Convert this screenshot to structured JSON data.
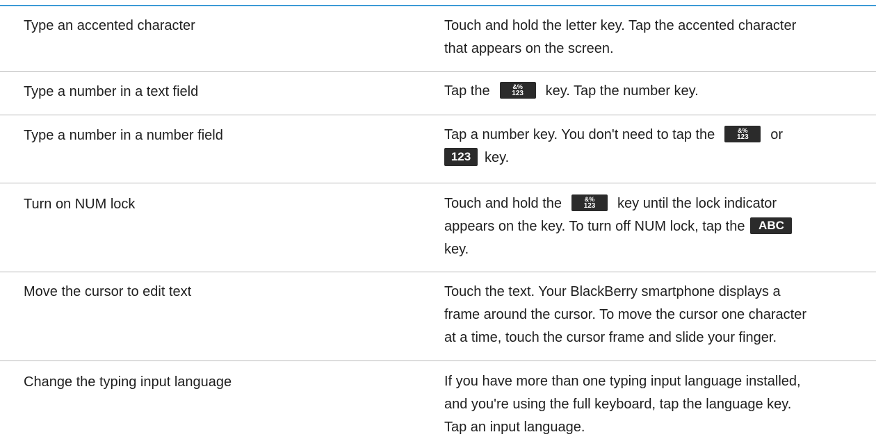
{
  "colors": {
    "rule": "#3d9ad6",
    "divider": "#b9b9b9",
    "key": "#2b2b2b"
  },
  "keys": {
    "symbol_top": "&%",
    "symbol_bottom": "123",
    "num": "123",
    "abc": "ABC"
  },
  "rows": [
    {
      "action": "Type an accented character",
      "lines": [
        "Touch and hold the letter key. Tap the accented character",
        "that appears on the screen."
      ]
    },
    {
      "action": "Type a number in a text field",
      "pre": "Tap the",
      "post": "key. Tap the number key."
    },
    {
      "action": "Type a number in a number field",
      "line1_pre": "Tap a number key. You don't need to tap the",
      "line1_post": "or",
      "line2_post": "key."
    },
    {
      "action": "Turn on NUM lock",
      "line1_pre": "Touch and hold the",
      "line1_post": "key until the lock indicator",
      "line2_pre": "appears on the key. To turn off NUM lock, tap the",
      "line3": "key."
    },
    {
      "action": "Move the cursor to edit text",
      "lines": [
        "Touch the text. Your BlackBerry smartphone displays a",
        "frame around the cursor. To move the cursor one character",
        "at a time, touch the cursor frame and slide your finger."
      ]
    },
    {
      "action": "Change the typing input language",
      "lines": [
        "If you have more than one typing input language installed,",
        "and you're using the full keyboard, tap the language key.",
        "Tap an input language."
      ]
    }
  ]
}
